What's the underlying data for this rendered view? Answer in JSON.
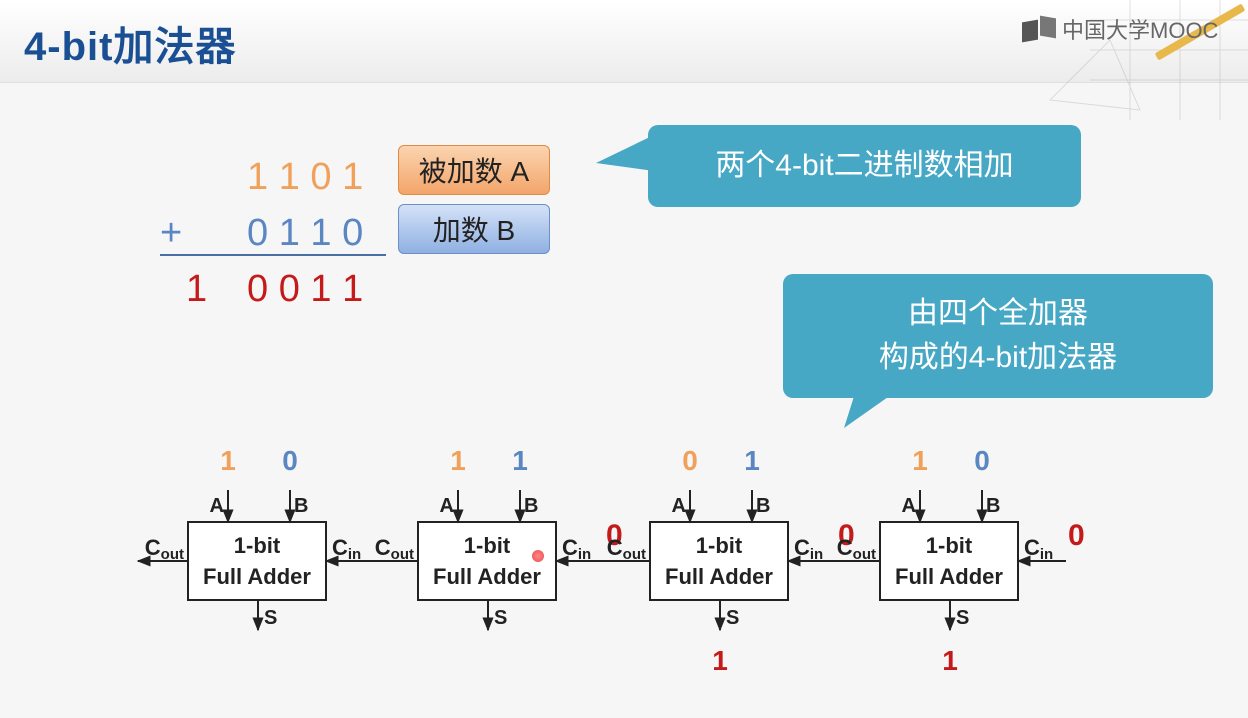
{
  "header": {
    "title": "4-bit加法器",
    "logo_text": "中国大学MOOC"
  },
  "addition": {
    "operand_a": "1 1 0 1",
    "plus": "+",
    "operand_b": "0 1 1 0",
    "sum_carry": "1",
    "sum": "0 0 1 1",
    "label_a": "被加数 A",
    "label_b": "加数 B"
  },
  "callouts": {
    "top": "两个4-bit二进制数相加",
    "bottom_line1": "由四个全加器",
    "bottom_line2": "构成的4-bit加法器"
  },
  "adders": [
    {
      "a_value": "1",
      "b_value": "0",
      "cin_value": "",
      "s_value": "",
      "line1": "1-bit",
      "line2": "Full Adder"
    },
    {
      "a_value": "1",
      "b_value": "1",
      "cin_value": "0",
      "s_value": "",
      "line1": "1-bit",
      "line2": "Full Adder"
    },
    {
      "a_value": "0",
      "b_value": "1",
      "cin_value": "0",
      "s_value": "1",
      "line1": "1-bit",
      "line2": "Full Adder"
    },
    {
      "a_value": "1",
      "b_value": "0",
      "cin_value": "0",
      "s_value": "1",
      "line1": "1-bit",
      "line2": "Full Adder"
    }
  ],
  "pin_labels": {
    "a": "A",
    "b": "B",
    "s": "S",
    "cin_main": "C",
    "cin_sub": "in",
    "cout_main": "C",
    "cout_sub": "out"
  },
  "colors": {
    "title": "#1a4f93",
    "operand_a": "#f0a058",
    "operand_b": "#5a86c2",
    "result": "#c41a1a",
    "callout": "#47a8c6"
  }
}
